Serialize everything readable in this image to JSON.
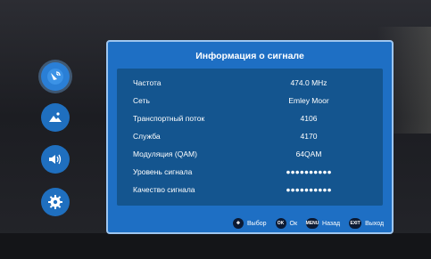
{
  "dialog": {
    "title": "Информация о сигнале",
    "rows": [
      {
        "label": "Частота",
        "value": "474.0 MHz"
      },
      {
        "label": "Сеть",
        "value": "Emley Moor"
      },
      {
        "label": "Транспортный поток",
        "value": "4106"
      },
      {
        "label": "Служба",
        "value": "4170"
      },
      {
        "label": "Модуляция (QAM)",
        "value": "64QAM"
      },
      {
        "label": "Уровень сигнала",
        "value": "●●●●●●●●●●"
      },
      {
        "label": "Качество сигнала",
        "value": "●●●●●●●●●●"
      }
    ]
  },
  "footer": {
    "select_label": "Выбор",
    "ok_key": "OK",
    "ok_label": "Ок",
    "menu_key": "MENU",
    "back_label": "Назад",
    "exit_key": "EXIT",
    "exit_label": "Выход"
  },
  "side_menu": {
    "items": [
      {
        "icon": "satellite-icon",
        "active": true
      },
      {
        "icon": "picture-icon",
        "active": false
      },
      {
        "icon": "sound-icon",
        "active": false
      },
      {
        "icon": "gear-icon",
        "active": false
      }
    ]
  },
  "colors": {
    "panel": "#1e6fc4",
    "inner": "#14558f",
    "accent": "#2a7fd6"
  }
}
